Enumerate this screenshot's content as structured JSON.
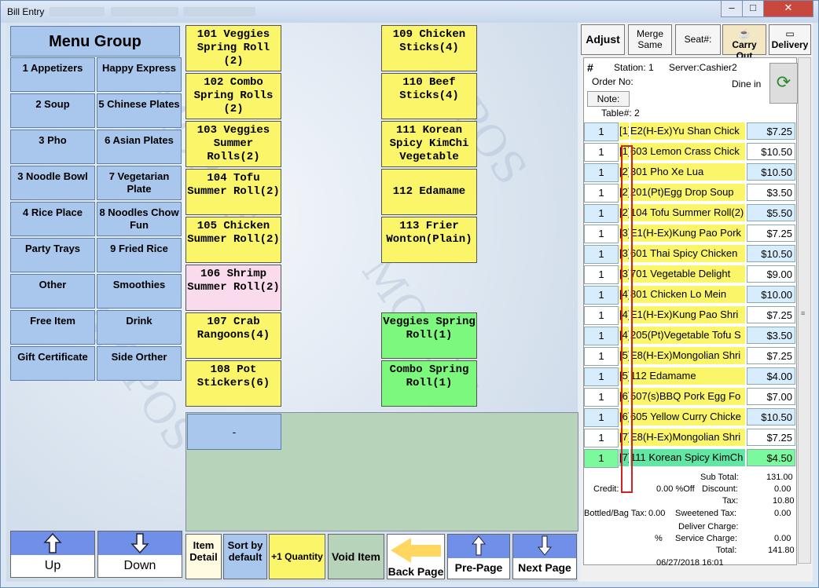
{
  "window": {
    "title": "Bill Entry",
    "buttons": {
      "minimize": "–",
      "maximize": "□",
      "close": "✕"
    }
  },
  "menu_group": {
    "title": "Menu Group",
    "items": [
      "1 Appetizers",
      "Happy Express",
      "2 Soup",
      "5 Chinese Plates",
      "3 Pho",
      "6 Asian Plates",
      "3 Noodle Bowl",
      "7 Vegetarian Plate",
      "4 Rice Place",
      "8 Noodles Chow Fun",
      "Party Trays",
      "9 Fried Rice",
      "Other",
      "Smoothies",
      "Free Item",
      "Drink",
      "Gift Certificate",
      "Side Orther"
    ]
  },
  "menu_items": {
    "col1": [
      "101 Veggies Spring Roll (2)",
      "102 Combo Spring Rolls (2)",
      "103 Veggies Summer Rolls(2)",
      "104 Tofu Summer Roll(2)",
      "105 Chicken Summer Roll(2)",
      "106 Shrimp Summer Roll(2)",
      "107 Crab Rangoons(4)",
      "108 Pot Stickers(6)"
    ],
    "col2": [
      "109 Chicken Sticks(4)",
      "110 Beef Sticks(4)",
      "111 Korean Spicy KimChi Vegetable",
      "112 Edamame",
      "113 Frier Wonton(Plain)"
    ],
    "modifiers": [
      "Veggies Spring Roll(1)",
      "Combo Spring Roll(1)"
    ],
    "dash_button": "-"
  },
  "nav": {
    "up": "Up",
    "down": "Down"
  },
  "bottom_buttons": {
    "item_detail": "Item Detail",
    "sort": "Sort by default",
    "quantity": "+1 Quantity",
    "void": "Void Item",
    "back": "Back Page",
    "pre": "Pre-Page",
    "next": "Next Page"
  },
  "toolbar": {
    "adjust": "Adjust",
    "merge": "Merge Same",
    "seat": "Seat#:",
    "carry_out": "Carry Out",
    "delivery": "Delivery"
  },
  "order": {
    "hash": "#",
    "station": "Station: 1",
    "server": "Server:Cashier2",
    "order_no": "Order No:",
    "dine_in": "Dine in",
    "note": "Note:",
    "table": "Table#:  2",
    "lines": [
      {
        "qty": "1",
        "seat": "[1]",
        "name": "E2(H-Ex)Yu Shan Chick",
        "price": "$7.25"
      },
      {
        "qty": "1",
        "seat": "[1]",
        "name": "603 Lemon Crass Chick",
        "price": "$10.50"
      },
      {
        "qty": "1",
        "seat": "[2]",
        "name": "301 Pho Xe Lua",
        "price": "$10.50"
      },
      {
        "qty": "1",
        "seat": "[2]",
        "name": "201(Pt)Egg Drop Soup",
        "price": "$3.50"
      },
      {
        "qty": "1",
        "seat": "[2]",
        "name": "104 Tofu Summer Roll(2)",
        "price": "$5.50"
      },
      {
        "qty": "1",
        "seat": "[3]",
        "name": "E1(H-Ex)Kung Pao Pork",
        "price": "$7.25"
      },
      {
        "qty": "1",
        "seat": "[3]",
        "name": "601 Thai Spicy Chicken",
        "price": "$10.50"
      },
      {
        "qty": "1",
        "seat": "[3]",
        "name": "701 Vegetable Delight",
        "price": "$9.00"
      },
      {
        "qty": "1",
        "seat": "[4]",
        "name": "801 Chicken Lo Mein",
        "price": "$10.00"
      },
      {
        "qty": "1",
        "seat": "[4]",
        "name": "E1(H-Ex)Kung Pao Shri",
        "price": "$7.25"
      },
      {
        "qty": "1",
        "seat": "[4]",
        "name": "205(Pt)Vegetable Tofu S",
        "price": "$3.50"
      },
      {
        "qty": "1",
        "seat": "[5]",
        "name": "E8(H-Ex)Mongolian Shri",
        "price": "$7.25"
      },
      {
        "qty": "1",
        "seat": "[5]",
        "name": "112 Edamame",
        "price": "$4.00"
      },
      {
        "qty": "1",
        "seat": "[6]",
        "name": "507(s)BBQ Pork Egg Fo",
        "price": "$7.00"
      },
      {
        "qty": "1",
        "seat": "[6]",
        "name": "605 Yellow Curry Chicke",
        "price": "$10.50"
      },
      {
        "qty": "1",
        "seat": "[7]",
        "name": "E8(H-Ex)Mongolian Shri",
        "price": "$7.25"
      },
      {
        "qty": "1",
        "seat": "[7]",
        "name": "111 Korean Spicy KimCh",
        "price": "$4.50"
      }
    ]
  },
  "summary": {
    "subtotal_label": "Sub Total:",
    "subtotal": "131.00",
    "credit_label": "Credit:",
    "off": "0.00 %Off",
    "discount_label": "Discount:",
    "discount": "0.00",
    "tax_label": "Tax:",
    "tax": "10.80",
    "bag_label": "Bottled/Bag Tax:",
    "bag": "0.00",
    "sweet_label": "Sweetened Tax:",
    "sweet": "0.00",
    "deliver_label": "Deliver Charge:",
    "pct": "%",
    "service_label": "Service Charge:",
    "service": "0.00",
    "total_label": "Total:",
    "total": "141.80",
    "datetime": "06/27/2018 16:01"
  }
}
